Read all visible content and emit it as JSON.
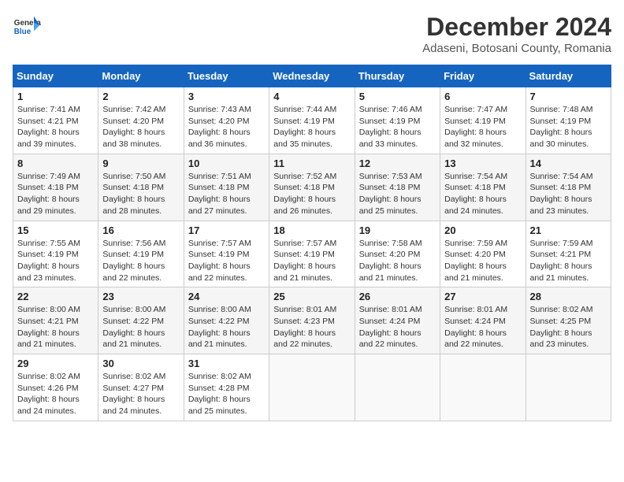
{
  "header": {
    "logo_line1": "General",
    "logo_line2": "Blue",
    "title": "December 2024",
    "subtitle": "Adaseni, Botosani County, Romania"
  },
  "calendar": {
    "days_of_week": [
      "Sunday",
      "Monday",
      "Tuesday",
      "Wednesday",
      "Thursday",
      "Friday",
      "Saturday"
    ],
    "weeks": [
      [
        {
          "day": "1",
          "sunrise": "7:41 AM",
          "sunset": "4:21 PM",
          "daylight": "8 hours and 39 minutes."
        },
        {
          "day": "2",
          "sunrise": "7:42 AM",
          "sunset": "4:20 PM",
          "daylight": "8 hours and 38 minutes."
        },
        {
          "day": "3",
          "sunrise": "7:43 AM",
          "sunset": "4:20 PM",
          "daylight": "8 hours and 36 minutes."
        },
        {
          "day": "4",
          "sunrise": "7:44 AM",
          "sunset": "4:19 PM",
          "daylight": "8 hours and 35 minutes."
        },
        {
          "day": "5",
          "sunrise": "7:46 AM",
          "sunset": "4:19 PM",
          "daylight": "8 hours and 33 minutes."
        },
        {
          "day": "6",
          "sunrise": "7:47 AM",
          "sunset": "4:19 PM",
          "daylight": "8 hours and 32 minutes."
        },
        {
          "day": "7",
          "sunrise": "7:48 AM",
          "sunset": "4:19 PM",
          "daylight": "8 hours and 30 minutes."
        }
      ],
      [
        {
          "day": "8",
          "sunrise": "7:49 AM",
          "sunset": "4:18 PM",
          "daylight": "8 hours and 29 minutes."
        },
        {
          "day": "9",
          "sunrise": "7:50 AM",
          "sunset": "4:18 PM",
          "daylight": "8 hours and 28 minutes."
        },
        {
          "day": "10",
          "sunrise": "7:51 AM",
          "sunset": "4:18 PM",
          "daylight": "8 hours and 27 minutes."
        },
        {
          "day": "11",
          "sunrise": "7:52 AM",
          "sunset": "4:18 PM",
          "daylight": "8 hours and 26 minutes."
        },
        {
          "day": "12",
          "sunrise": "7:53 AM",
          "sunset": "4:18 PM",
          "daylight": "8 hours and 25 minutes."
        },
        {
          "day": "13",
          "sunrise": "7:54 AM",
          "sunset": "4:18 PM",
          "daylight": "8 hours and 24 minutes."
        },
        {
          "day": "14",
          "sunrise": "7:54 AM",
          "sunset": "4:18 PM",
          "daylight": "8 hours and 23 minutes."
        }
      ],
      [
        {
          "day": "15",
          "sunrise": "7:55 AM",
          "sunset": "4:19 PM",
          "daylight": "8 hours and 23 minutes."
        },
        {
          "day": "16",
          "sunrise": "7:56 AM",
          "sunset": "4:19 PM",
          "daylight": "8 hours and 22 minutes."
        },
        {
          "day": "17",
          "sunrise": "7:57 AM",
          "sunset": "4:19 PM",
          "daylight": "8 hours and 22 minutes."
        },
        {
          "day": "18",
          "sunrise": "7:57 AM",
          "sunset": "4:19 PM",
          "daylight": "8 hours and 21 minutes."
        },
        {
          "day": "19",
          "sunrise": "7:58 AM",
          "sunset": "4:20 PM",
          "daylight": "8 hours and 21 minutes."
        },
        {
          "day": "20",
          "sunrise": "7:59 AM",
          "sunset": "4:20 PM",
          "daylight": "8 hours and 21 minutes."
        },
        {
          "day": "21",
          "sunrise": "7:59 AM",
          "sunset": "4:21 PM",
          "daylight": "8 hours and 21 minutes."
        }
      ],
      [
        {
          "day": "22",
          "sunrise": "8:00 AM",
          "sunset": "4:21 PM",
          "daylight": "8 hours and 21 minutes."
        },
        {
          "day": "23",
          "sunrise": "8:00 AM",
          "sunset": "4:22 PM",
          "daylight": "8 hours and 21 minutes."
        },
        {
          "day": "24",
          "sunrise": "8:00 AM",
          "sunset": "4:22 PM",
          "daylight": "8 hours and 21 minutes."
        },
        {
          "day": "25",
          "sunrise": "8:01 AM",
          "sunset": "4:23 PM",
          "daylight": "8 hours and 22 minutes."
        },
        {
          "day": "26",
          "sunrise": "8:01 AM",
          "sunset": "4:24 PM",
          "daylight": "8 hours and 22 minutes."
        },
        {
          "day": "27",
          "sunrise": "8:01 AM",
          "sunset": "4:24 PM",
          "daylight": "8 hours and 22 minutes."
        },
        {
          "day": "28",
          "sunrise": "8:02 AM",
          "sunset": "4:25 PM",
          "daylight": "8 hours and 23 minutes."
        }
      ],
      [
        {
          "day": "29",
          "sunrise": "8:02 AM",
          "sunset": "4:26 PM",
          "daylight": "8 hours and 24 minutes."
        },
        {
          "day": "30",
          "sunrise": "8:02 AM",
          "sunset": "4:27 PM",
          "daylight": "8 hours and 24 minutes."
        },
        {
          "day": "31",
          "sunrise": "8:02 AM",
          "sunset": "4:28 PM",
          "daylight": "8 hours and 25 minutes."
        },
        null,
        null,
        null,
        null
      ]
    ]
  }
}
